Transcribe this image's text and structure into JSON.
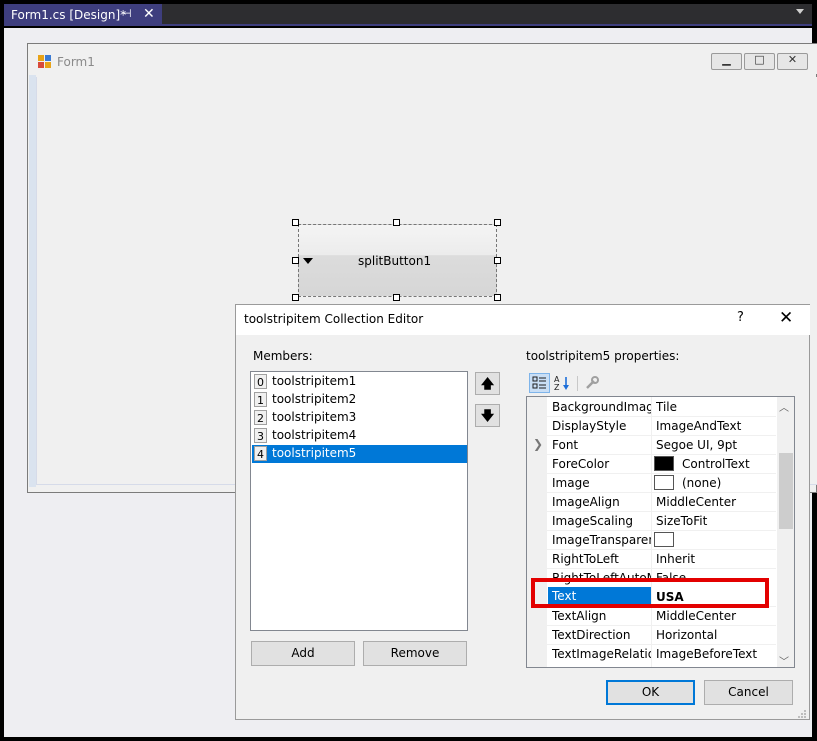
{
  "ide": {
    "tab_title": "Form1.cs [Design]*",
    "tab_pin_icon": "⊣",
    "tab_close_icon": "✕"
  },
  "form": {
    "title": "Form1",
    "icon": "form-icon",
    "minimize_icon": "▁",
    "maximize_icon": "□",
    "close_icon": "✕"
  },
  "split_button": {
    "label": "splitButton1",
    "arrow_icon": "dropdown-arrow-icon"
  },
  "dialog": {
    "title": "toolstripitem Collection Editor",
    "help": "?",
    "close": "✕",
    "members_label": "Members:",
    "members": [
      {
        "index": "0",
        "name": "toolstripitem1",
        "selected": false
      },
      {
        "index": "1",
        "name": "toolstripitem2",
        "selected": false
      },
      {
        "index": "2",
        "name": "toolstripitem3",
        "selected": false
      },
      {
        "index": "3",
        "name": "toolstripitem4",
        "selected": false
      },
      {
        "index": "4",
        "name": "toolstripitem5",
        "selected": true
      }
    ],
    "move_up_icon": "🡅",
    "move_down_icon": "🡇",
    "add_label": "Add",
    "remove_label": "Remove",
    "properties_label": "toolstripitem5 properties:",
    "properties": [
      {
        "name": "BackgroundImageLayout",
        "value": "Tile"
      },
      {
        "name": "DisplayStyle",
        "value": "ImageAndText"
      },
      {
        "name": "Font",
        "value": "Segoe UI, 9pt",
        "expandable": true
      },
      {
        "name": "ForeColor",
        "value": "ControlText",
        "swatch": "#000000"
      },
      {
        "name": "Image",
        "value": "(none)",
        "swatch": "#ffffff"
      },
      {
        "name": "ImageAlign",
        "value": "MiddleCenter"
      },
      {
        "name": "ImageScaling",
        "value": "SizeToFit"
      },
      {
        "name": "ImageTransparentColor",
        "value": "",
        "swatch": "#ffffff"
      },
      {
        "name": "RightToLeft",
        "value": "Inherit"
      },
      {
        "name": "RightToLeftAutoMirrorImage",
        "value": "False"
      },
      {
        "name": "Text",
        "value": "USA",
        "selected": true
      },
      {
        "name": "TextAlign",
        "value": "MiddleCenter"
      },
      {
        "name": "TextDirection",
        "value": "Horizontal"
      },
      {
        "name": "TextImageRelation",
        "value": "ImageBeforeText"
      }
    ],
    "ok_label": "OK",
    "cancel_label": "Cancel"
  },
  "colors": {
    "selection": "#0078d7",
    "highlight_box": "#e30000",
    "tab_accent": "#3e3e7e"
  }
}
